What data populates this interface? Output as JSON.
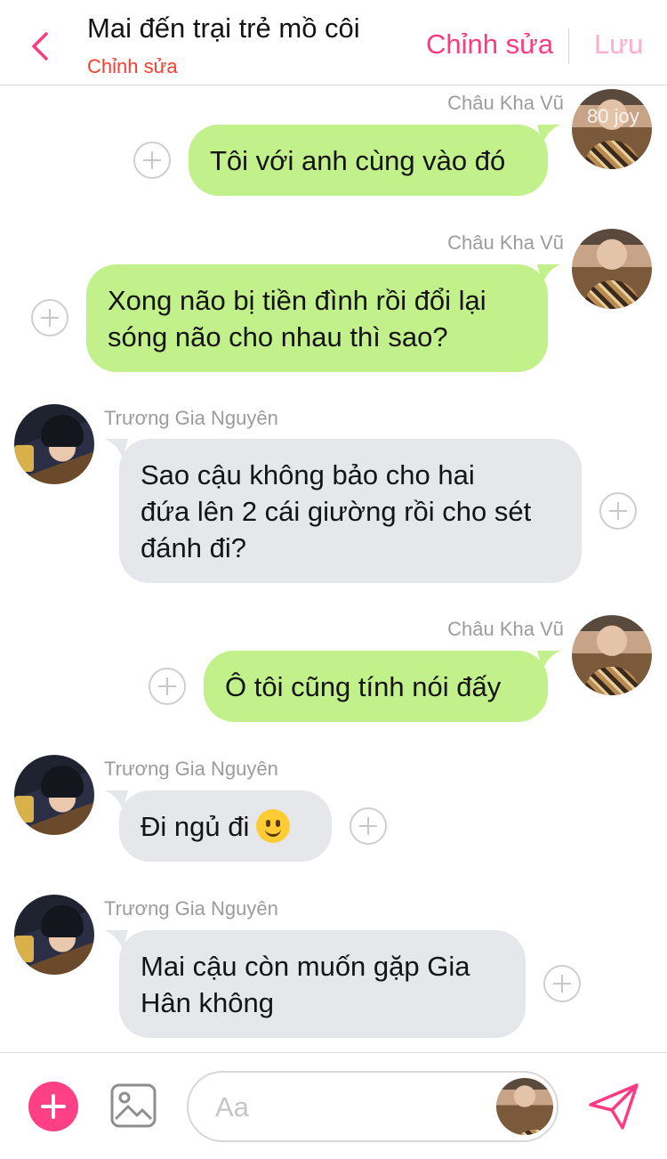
{
  "header": {
    "title": "Mai đến trại trẻ mồ côi",
    "subtitle": "Chỉnh sửa",
    "edit_label": "Chỉnh sửa",
    "save_label": "Lưu",
    "accent_color": "#ff3a82"
  },
  "watermark": "80 joy",
  "messages": [
    {
      "sender": "Châu Kha Vũ",
      "side": "right",
      "lines": [
        "Tôi với anh cùng vào đó"
      ]
    },
    {
      "sender": "Châu Kha Vũ",
      "side": "right",
      "lines": [
        "Xong não bị tiền đình rồi đổi lại",
        "sóng não cho nhau thì sao?"
      ]
    },
    {
      "sender": "Trương Gia Nguyên",
      "side": "left",
      "lines": [
        "Sao cậu không bảo cho hai",
        "đứa lên 2 cái giường rồi cho sét",
        "đánh đi?"
      ]
    },
    {
      "sender": "Châu Kha Vũ",
      "side": "right",
      "lines": [
        "Ô tôi cũng tính nói đấy"
      ]
    },
    {
      "sender": "Trương Gia Nguyên",
      "side": "left",
      "lines": [
        "Đi ngủ đi"
      ],
      "emoji": "slightly-smiling-face"
    },
    {
      "sender": "Trương Gia Nguyên",
      "side": "left",
      "lines": [
        "Mai cậu còn muốn gặp Gia",
        "Hân không"
      ]
    }
  ],
  "composer": {
    "placeholder": "Aa",
    "icons": [
      "plus-icon",
      "image-icon",
      "send-icon"
    ]
  },
  "colors": {
    "outgoing_bubble": "#c2f08a",
    "incoming_bubble": "#e5e7ea",
    "accent": "#ff3f86"
  }
}
